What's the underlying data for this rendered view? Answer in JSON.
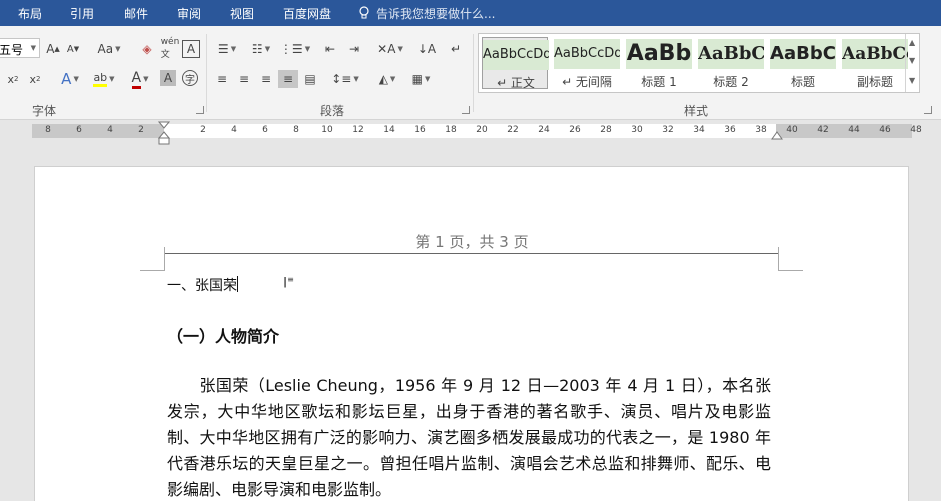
{
  "menu": {
    "tabs": [
      "布局",
      "引用",
      "邮件",
      "审阅",
      "视图",
      "百度网盘"
    ],
    "tell_me": "告诉我您想要做什么..."
  },
  "ribbon": {
    "font_size": "五号",
    "font_group_label": "字体",
    "paragraph_group_label": "段落",
    "styles_group_label": "样式",
    "styles": [
      {
        "sample": "AaBbCcDd",
        "name": "↵ 正文"
      },
      {
        "sample": "AaBbCcDd",
        "name": "↵ 无间隔"
      },
      {
        "sample": "AaBb",
        "name": "标题 1"
      },
      {
        "sample": "AaBbC",
        "name": "标题 2"
      },
      {
        "sample": "AaBbC",
        "name": "标题"
      },
      {
        "sample": "AaBbCc",
        "name": "副标题"
      }
    ]
  },
  "ruler": {
    "ticks": [
      "8",
      "6",
      "4",
      "2",
      "2",
      "4",
      "6",
      "8",
      "10",
      "12",
      "14",
      "16",
      "18",
      "20",
      "22",
      "24",
      "26",
      "28",
      "30",
      "32",
      "34",
      "36",
      "38",
      "40",
      "42",
      "44",
      "46",
      "48"
    ]
  },
  "document": {
    "header": "第 1 页，共 3 页",
    "heading1": "一、张国荣",
    "heading2": "（一）人物简介",
    "paragraph": "张国荣（Leslie Cheung，1956 年 9 月 12 日—2003 年 4 月 1 日），本名张发宗，大中华地区歌坛和影坛巨星，出身于香港的著名歌手、演员、唱片及电影监制、大中华地区拥有广泛的影响力、演艺圈多栖发展最成功的代表之一，是 1980 年代香港乐坛的天皇巨星之一。曾担任唱片监制、演唱会艺术总监和排舞师、配乐、电影编剧、电影导演和电影监制。"
  },
  "colors": {
    "menubar": "#2b579a",
    "style_sample_bg": "#d9ead3"
  }
}
